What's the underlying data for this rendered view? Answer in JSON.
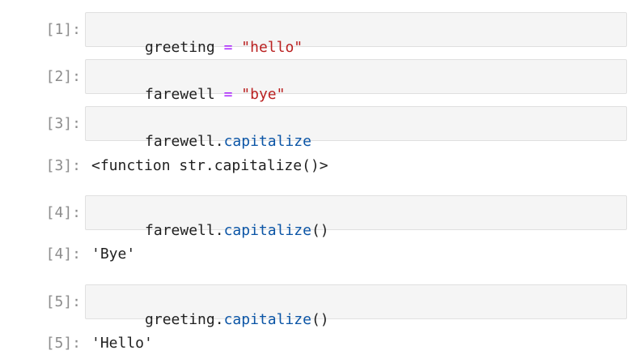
{
  "cells": [
    {
      "in_prompt": "[1]:",
      "code": [
        {
          "t": "greeting ",
          "k": "name"
        },
        {
          "t": "=",
          "k": "op"
        },
        {
          "t": " ",
          "k": "name"
        },
        {
          "t": "\"hello\"",
          "k": "str"
        }
      ]
    },
    {
      "in_prompt": "[2]:",
      "code": [
        {
          "t": "farewell ",
          "k": "name"
        },
        {
          "t": "=",
          "k": "op"
        },
        {
          "t": " ",
          "k": "name"
        },
        {
          "t": "\"bye\"",
          "k": "str"
        }
      ]
    },
    {
      "in_prompt": "[3]:",
      "code": [
        {
          "t": "farewell.",
          "k": "name"
        },
        {
          "t": "capitalize",
          "k": "attr"
        }
      ],
      "out_prompt": "[3]:",
      "output": "<function str.capitalize()>"
    },
    {
      "in_prompt": "[4]:",
      "code": [
        {
          "t": "farewell.",
          "k": "name"
        },
        {
          "t": "capitalize",
          "k": "attr"
        },
        {
          "t": "()",
          "k": "name"
        }
      ],
      "out_prompt": "[4]:",
      "output": "'Bye'"
    },
    {
      "in_prompt": "[5]:",
      "code": [
        {
          "t": "greeting.",
          "k": "name"
        },
        {
          "t": "capitalize",
          "k": "attr"
        },
        {
          "t": "()",
          "k": "name"
        }
      ],
      "out_prompt": "[5]:",
      "output": "'Hello'"
    }
  ],
  "colors": {
    "prompt": "#8c8c8c",
    "operator": "#aa22ff",
    "string": "#ba2121",
    "attribute": "#0b55a6",
    "code_background": "#f5f5f5"
  }
}
